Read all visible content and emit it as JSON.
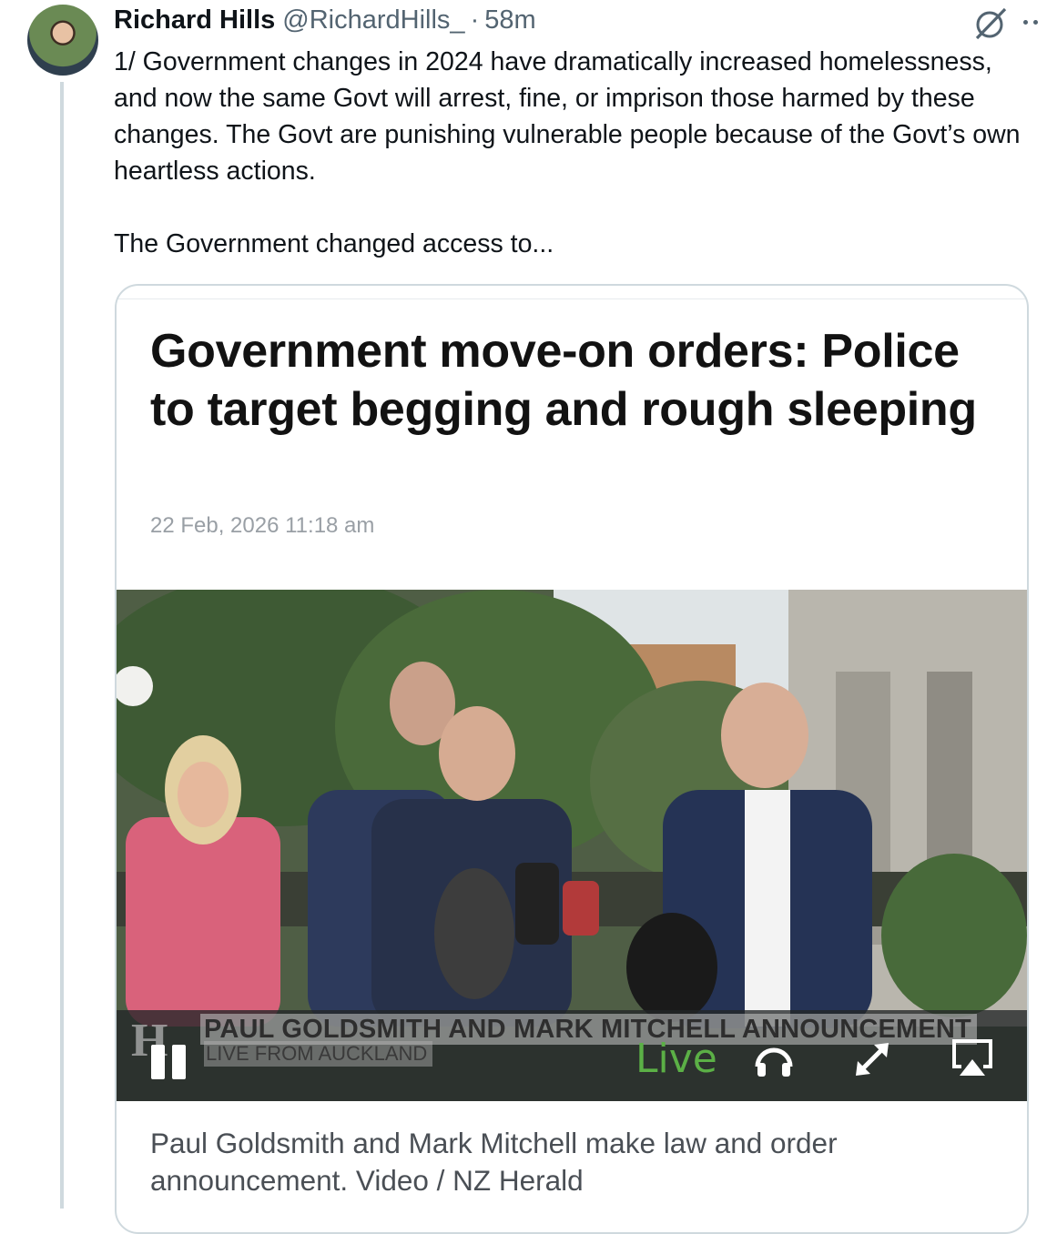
{
  "author": {
    "name": "Richard Hills",
    "handle": "@RichardHills_",
    "separator": "·",
    "time": "58m"
  },
  "tweet": {
    "text": "1/ Government changes in 2024 have dramatically increased homelessness, and now the same Govt will arrest, fine, or imprison those harmed by these changes. The Govt are punishing vulnerable people because of the Govt’s own heartless actions.\n\nThe Government changed access to..."
  },
  "card": {
    "headline": "Government move-on orders: Police to target begging and rough sleeping",
    "date": "22 Feb, 2026 11:18 am",
    "video": {
      "lower_third_title": "PAUL GOLDSMITH AND MARK MITCHELL ANNOUNCEMENT",
      "lower_third_subtitle": "LIVE FROM AUCKLAND",
      "live_label": "Live",
      "logo_letter": "H"
    },
    "caption": "Paul Goldsmith and Mark Mitchell make law and order announcement. Video / NZ Herald"
  },
  "icons": [
    "grok-icon",
    "more-icon",
    "pause-icon",
    "headphone-icon",
    "expand-icon",
    "airplay-icon"
  ],
  "colors": {
    "secondary_text": "#536471",
    "live_green": "#5bb046",
    "thread_line": "#cfd9de"
  }
}
